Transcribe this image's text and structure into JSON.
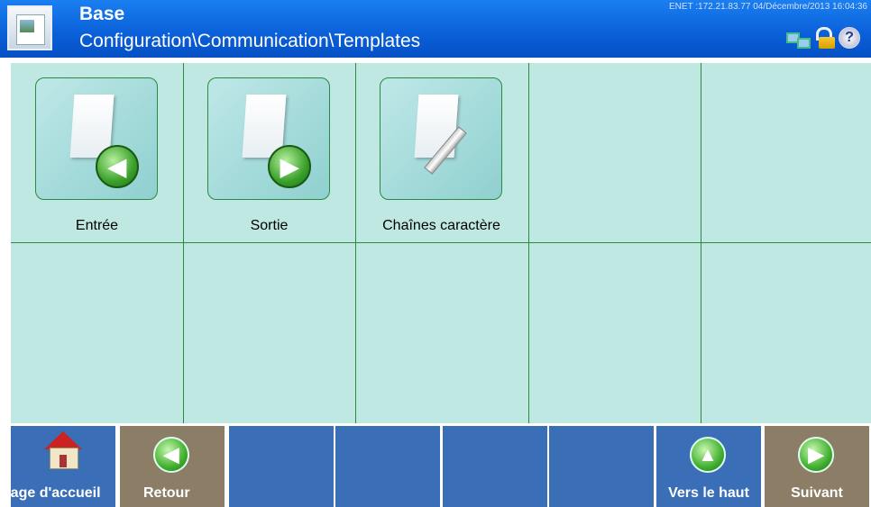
{
  "header": {
    "title": "Base",
    "path": "Configuration\\Communication\\Templates",
    "status": "ENET :172.21.83.77  04/Décembre/2013 16:04:36",
    "icons": [
      "network-icon",
      "lock-open-icon",
      "help-icon"
    ],
    "help_glyph": "?"
  },
  "grid": {
    "cells": [
      {
        "label": "Entrée",
        "icon": "document-arrow-left-icon"
      },
      {
        "label": "Sortie",
        "icon": "document-arrow-right-icon"
      },
      {
        "label": "Chaînes caractère",
        "icon": "document-pencil-icon"
      }
    ]
  },
  "softkeys": [
    {
      "label": "Page d'accueil",
      "icon": "home-icon"
    },
    {
      "label": "Retour",
      "icon": "arrow-left-icon"
    },
    {
      "label": ""
    },
    {
      "label": ""
    },
    {
      "label": ""
    },
    {
      "label": ""
    },
    {
      "label": "Vers le haut",
      "icon": "arrow-up-icon"
    },
    {
      "label": "Suivant",
      "icon": "arrow-right-icon"
    }
  ],
  "colors": {
    "header": "#0a5fd8",
    "grid": "#bfe8e3",
    "softkey_blue": "#3a6fb8",
    "softkey_tan": "#8b7d66"
  }
}
